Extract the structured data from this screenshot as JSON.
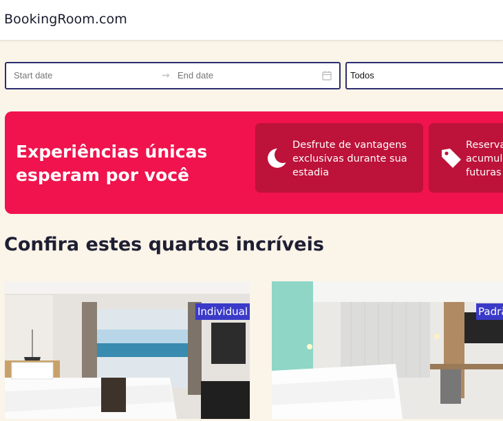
{
  "header": {
    "logo": "BookingRoom.com"
  },
  "search": {
    "start_placeholder": "Start date",
    "end_placeholder": "End date",
    "range_separator_icon": "arrow-right-icon",
    "calendar_icon": "calendar-icon",
    "room_type_value": "Todos"
  },
  "promo": {
    "title": "Experiências únicas esperam por você",
    "benefits": [
      {
        "icon": "moon-icon",
        "text": "Desfrute de vantagens exclusivas durante sua estadia"
      },
      {
        "icon": "tag-icon",
        "text": "Reservas acumulam futuras"
      }
    ]
  },
  "rooms_section": {
    "title": "Confira estes quartos incríveis",
    "rooms": [
      {
        "type": "Individual"
      },
      {
        "type": "Padrão"
      }
    ]
  },
  "colors": {
    "background": "#faf4e9",
    "accent": "#f0134d",
    "accent_dark": "#bd1239",
    "input_border": "#2b2d6e",
    "badge": "#3a3ac8"
  }
}
